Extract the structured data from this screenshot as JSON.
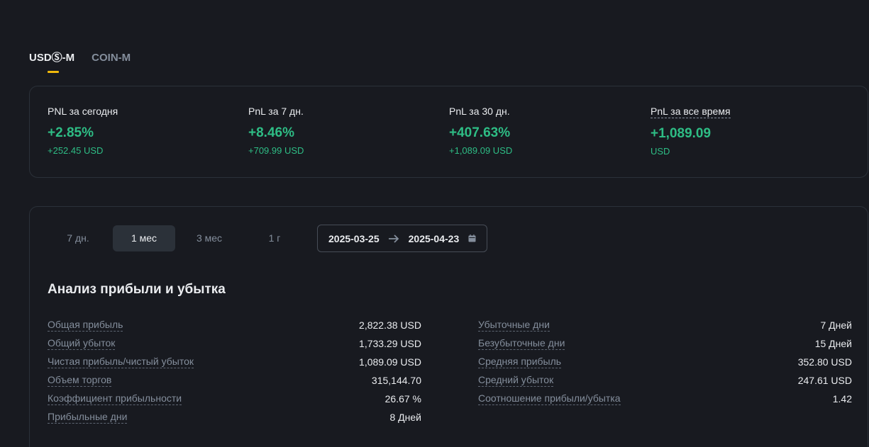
{
  "tabs": [
    {
      "label": "USDⓈ-M",
      "active": true
    },
    {
      "label": "COIN-M",
      "active": false
    }
  ],
  "pnl": [
    {
      "label": "PNL за сегодня",
      "pct": "+2.85%",
      "usd": "+252.45 USD"
    },
    {
      "label": "PnL за 7 дн.",
      "pct": "+8.46%",
      "usd": "+709.99 USD"
    },
    {
      "label": "PnL за 30 дн.",
      "pct": "+407.63%",
      "usd": "+1,089.09 USD"
    },
    {
      "label": "PnL за все время",
      "pct": "+1,089.09",
      "usd": "USD"
    }
  ],
  "periods": [
    {
      "label": "7 дн.",
      "active": false
    },
    {
      "label": "1 мес",
      "active": true
    },
    {
      "label": "3 мес",
      "active": false
    },
    {
      "label": "1 г",
      "active": false
    }
  ],
  "date_range": {
    "start": "2025-03-25",
    "end": "2025-04-23"
  },
  "analysis": {
    "title": "Анализ прибыли и убытка",
    "left": [
      {
        "label": "Общая прибыль",
        "value": "2,822.38 USD"
      },
      {
        "label": "Общий убыток",
        "value": "1,733.29 USD"
      },
      {
        "label": "Чистая прибыль/чистый убыток",
        "value": "1,089.09 USD"
      },
      {
        "label": "Объем торгов",
        "value": "315,144.70"
      },
      {
        "label": "Коэффициент прибыльности",
        "value": "26.67 %"
      },
      {
        "label": "Прибыльные дни",
        "value": "8 Дней"
      }
    ],
    "right": [
      {
        "label": "Убыточные дни",
        "value": "7 Дней"
      },
      {
        "label": "Безубыточные дни",
        "value": "15 Дней"
      },
      {
        "label": "Средняя прибыль",
        "value": "352.80 USD"
      },
      {
        "label": "Средний убыток",
        "value": "247.61 USD"
      },
      {
        "label": "Соотношение прибыли/убытка",
        "value": "1.42"
      }
    ]
  },
  "colors": {
    "accent": "#f0b90b",
    "positive": "#2ebd85",
    "background": "#181a20",
    "border": "#2b3139"
  }
}
